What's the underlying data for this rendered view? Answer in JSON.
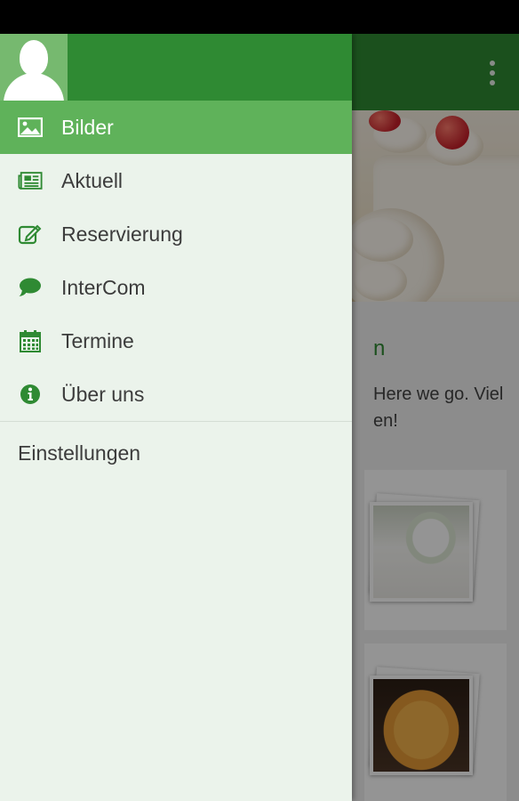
{
  "colors": {
    "primary": "#2f8a33",
    "primary_light": "#5fb25a",
    "drawer_bg": "#ebf3eb",
    "icon_green": "#2f8a33"
  },
  "app_bar": {
    "overflow_icon": "overflow-menu-icon"
  },
  "background": {
    "section_title": "n",
    "intro_text": "Here we go. Viel\nen!"
  },
  "drawer": {
    "avatar_icon": "user-avatar-icon",
    "items": [
      {
        "label": "Bilder",
        "icon": "image-icon",
        "active": true
      },
      {
        "label": "Aktuell",
        "icon": "newspaper-icon",
        "active": false
      },
      {
        "label": "Reservierung",
        "icon": "edit-icon",
        "active": false
      },
      {
        "label": "InterCom",
        "icon": "chat-bubble-icon",
        "active": false
      },
      {
        "label": "Termine",
        "icon": "calendar-icon",
        "active": false
      },
      {
        "label": "Über uns",
        "icon": "info-icon",
        "active": false
      }
    ],
    "settings_label": "Einstellungen"
  }
}
